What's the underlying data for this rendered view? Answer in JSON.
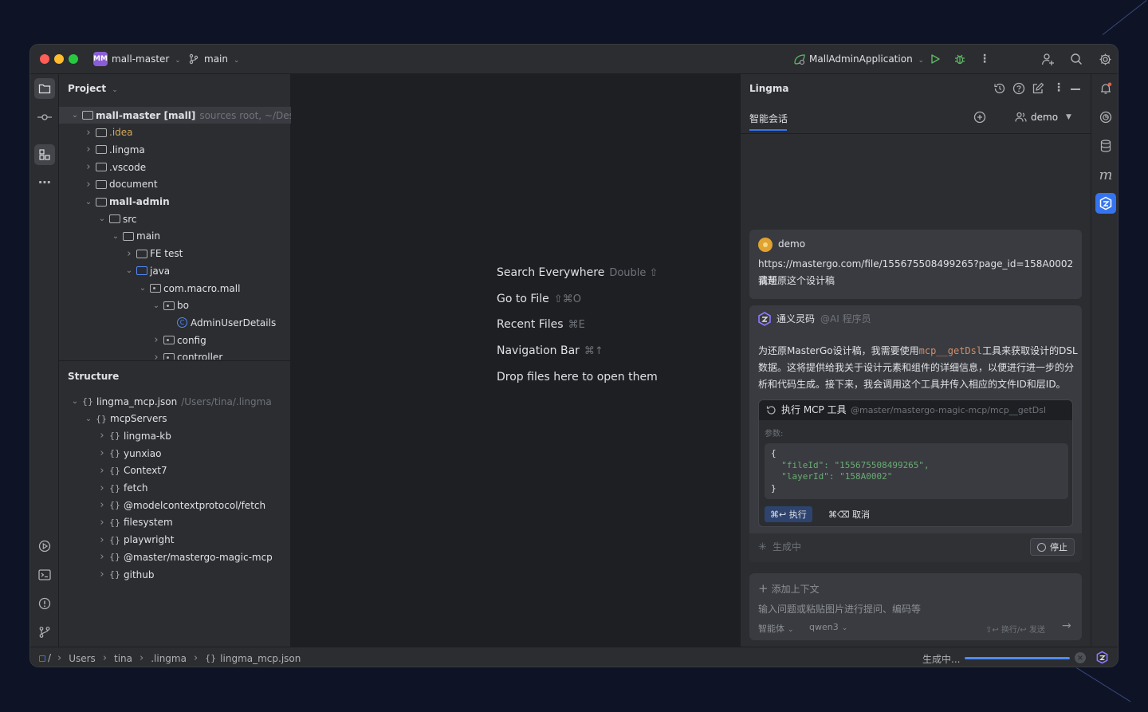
{
  "titlebar": {
    "project_badge": "MM",
    "project_name": "mall-master",
    "branch": "main",
    "run_config": "MallAdminApplication"
  },
  "project_panel": {
    "title": "Project",
    "tree": [
      {
        "label": "mall-master [mall]",
        "hint": "sources root, ~/Desktop/",
        "depth": 0,
        "expanded": true,
        "type": "folder",
        "bold": true
      },
      {
        "label": ".idea",
        "depth": 1,
        "expanded": false,
        "type": "folder",
        "color": "#d5a75f"
      },
      {
        "label": ".lingma",
        "depth": 1,
        "expanded": false,
        "type": "folder"
      },
      {
        "label": ".vscode",
        "depth": 1,
        "expanded": false,
        "type": "folder"
      },
      {
        "label": "document",
        "depth": 1,
        "expanded": false,
        "type": "folder"
      },
      {
        "label": "mall-admin",
        "depth": 1,
        "expanded": true,
        "type": "folder",
        "bold": true
      },
      {
        "label": "src",
        "depth": 2,
        "expanded": true,
        "type": "folder"
      },
      {
        "label": "main",
        "depth": 3,
        "expanded": true,
        "type": "folder"
      },
      {
        "label": "FE test",
        "depth": 4,
        "expanded": false,
        "type": "folder"
      },
      {
        "label": "java",
        "depth": 4,
        "expanded": true,
        "type": "folder",
        "blue": true
      },
      {
        "label": "com.macro.mall",
        "depth": 5,
        "expanded": true,
        "type": "package"
      },
      {
        "label": "bo",
        "depth": 6,
        "expanded": true,
        "type": "package"
      },
      {
        "label": "AdminUserDetails",
        "depth": 7,
        "type": "class"
      },
      {
        "label": "config",
        "depth": 6,
        "expanded": false,
        "type": "package"
      },
      {
        "label": "controller",
        "depth": 6,
        "expanded": false,
        "type": "package"
      }
    ]
  },
  "structure_panel": {
    "title": "Structure",
    "tree": [
      {
        "label": "lingma_mcp.json",
        "hint": "/Users/tina/.lingma",
        "depth": 0,
        "expanded": true
      },
      {
        "label": "mcpServers",
        "depth": 1,
        "expanded": true
      },
      {
        "label": "lingma-kb",
        "depth": 2,
        "expanded": false
      },
      {
        "label": "yunxiao",
        "depth": 2,
        "expanded": false
      },
      {
        "label": "Context7",
        "depth": 2,
        "expanded": false
      },
      {
        "label": "fetch",
        "depth": 2,
        "expanded": false
      },
      {
        "label": "@modelcontextprotocol/fetch",
        "depth": 2,
        "expanded": false
      },
      {
        "label": "filesystem",
        "depth": 2,
        "expanded": false
      },
      {
        "label": "playwright",
        "depth": 2,
        "expanded": false
      },
      {
        "label": "@master/mastergo-magic-mcp",
        "depth": 2,
        "expanded": false
      },
      {
        "label": "github",
        "depth": 2,
        "expanded": false
      }
    ]
  },
  "editor": {
    "hints": [
      {
        "label": "Search Everywhere",
        "shortcut": "Double ⇧"
      },
      {
        "label": "Go to File",
        "shortcut": "⇧⌘O"
      },
      {
        "label": "Recent Files",
        "shortcut": "⌘E"
      },
      {
        "label": "Navigation Bar",
        "shortcut": "⌘↑"
      },
      {
        "label": "Drop files here to open them",
        "shortcut": ""
      }
    ]
  },
  "lingma": {
    "title": "Lingma",
    "tab": "智能会话",
    "user": "demo",
    "user_message": {
      "author": "demo",
      "line1": "https://mastergo.com/file/155675508499265?page_id=158A0002 请帮",
      "line2": "我还原这个设计稿"
    },
    "assistant": {
      "name": "通义灵码",
      "role": "@AI 程序员",
      "para_line1_pre": "为还原MasterGo设计稿，我需要使用",
      "para_line1_code": "mcp__getDsl",
      "para_line1_post": "工具来获取设计的DSL",
      "para_line2": "数据。这将提供给我关于设计元素和组件的详细信息，以便进行进一步的分",
      "para_line3": "析和代码生成。接下来，我会调用这个工具并传入相应的文件ID和层ID。"
    },
    "tool_call": {
      "title": "执行 MCP 工具",
      "tool_path": "@master/mastergo-magic-mcp/mcp__getDsl",
      "params_label": "参数:",
      "code_lines": [
        "{",
        "  \"fileId\": \"155675508499265\",",
        "  \"layerId\": \"158A0002\"",
        "}"
      ],
      "run_label": "⌘↩ 执行",
      "cancel_label": "⌘⌫ 取消"
    },
    "generating": "生成中",
    "stop": "停止",
    "input": {
      "add_context": "添加上下文",
      "placeholder": "输入问题或粘贴图片进行提问、编码等",
      "mode": "智能体",
      "model": "qwen3",
      "send_hint": "⇧↩ 换行/↩ 发送"
    }
  },
  "statusbar": {
    "breadcrumb": [
      "Users",
      "tina",
      ".lingma",
      "lingma_mcp.json"
    ],
    "progress_label": "生成中...",
    "progress": 1.0
  },
  "colors": {
    "accent": "#3574f0",
    "background": "#0e1326",
    "panel": "#2b2d30",
    "editor": "#1e1f22",
    "green": "#5fb865",
    "code_string": "#6aab73",
    "code_orange": "#cf8e6d"
  }
}
